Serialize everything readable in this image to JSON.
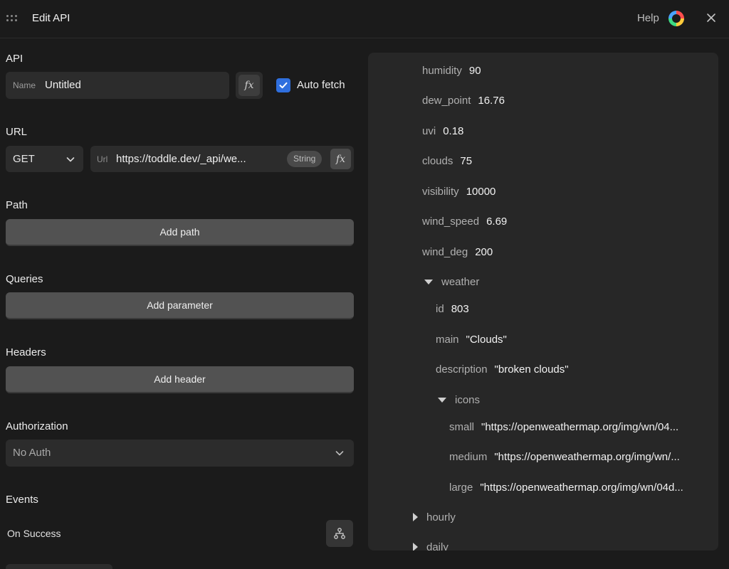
{
  "header": {
    "title": "Edit API",
    "help_label": "Help"
  },
  "api": {
    "section_label": "API",
    "name_label": "Name",
    "name_value": "Untitled",
    "fx_label": "fx",
    "auto_fetch_label": "Auto fetch",
    "auto_fetch_checked": true
  },
  "url": {
    "section_label": "URL",
    "method": "GET",
    "url_label": "Url",
    "url_value": "https://toddle.dev/_api/we...",
    "type_badge": "String",
    "fx_label": "fx"
  },
  "path": {
    "section_label": "Path",
    "button_label": "Add path"
  },
  "queries": {
    "section_label": "Queries",
    "button_label": "Add parameter"
  },
  "headers": {
    "section_label": "Headers",
    "button_label": "Add header"
  },
  "authorization": {
    "section_label": "Authorization",
    "value": "No Auth"
  },
  "events": {
    "section_label": "Events",
    "on_success_label": "On Success"
  },
  "response": {
    "rows": [
      {
        "key": "humidity",
        "value": "90"
      },
      {
        "key": "dew_point",
        "value": "16.76"
      },
      {
        "key": "uvi",
        "value": "0.18"
      },
      {
        "key": "clouds",
        "value": "75"
      },
      {
        "key": "visibility",
        "value": "10000"
      },
      {
        "key": "wind_speed",
        "value": "6.69"
      },
      {
        "key": "wind_deg",
        "value": "200"
      }
    ],
    "weather_key": "weather",
    "weather_rows": [
      {
        "key": "id",
        "value": "803"
      },
      {
        "key": "main",
        "value": "\"Clouds\""
      },
      {
        "key": "description",
        "value": "\"broken clouds\""
      }
    ],
    "icons_key": "icons",
    "icons_rows": [
      {
        "key": "small",
        "value": "\"https://openweathermap.org/img/wn/04..."
      },
      {
        "key": "medium",
        "value": "\"https://openweathermap.org/img/wn/..."
      },
      {
        "key": "large",
        "value": "\"https://openweathermap.org/img/wn/04d..."
      }
    ],
    "hourly_key": "hourly",
    "daily_key": "daily"
  },
  "colors": {
    "background": "#1b1b1b",
    "panel": "#272727",
    "accent_checkbox": "#2f6fde"
  }
}
